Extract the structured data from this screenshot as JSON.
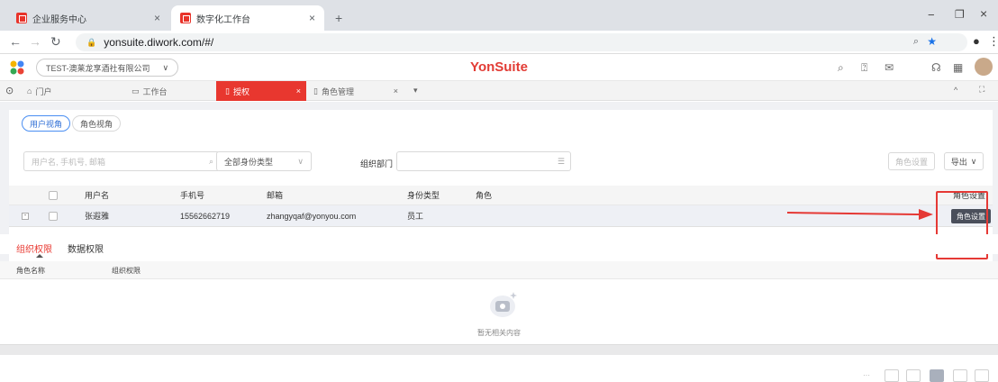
{
  "browser": {
    "tabs": [
      {
        "title": "企业服务中心",
        "close": "×"
      },
      {
        "title": "数字化工作台",
        "close": "×"
      }
    ],
    "new_tab": "+",
    "url": "yonsuite.diwork.com/#/",
    "window_controls": {
      "minimize": "−",
      "restore": "❐",
      "close": "×"
    }
  },
  "header": {
    "company": "TEST-澳莱龙享酒社有限公司",
    "company_caret": "∨",
    "brand": "YonSuite",
    "brand_color": "#e23c35"
  },
  "workspace_tabs": {
    "home": "门户",
    "workbench": "工作台",
    "active": "授权",
    "active_close": "×",
    "role_mgmt": "角色管理",
    "role_mgmt_close": "×",
    "dropdown": "▾",
    "collapse": "^",
    "expand": "⛶",
    "accent": "#e8372f"
  },
  "view_switch": {
    "user_view": "用户视角",
    "role_view": "角色视角"
  },
  "filters": {
    "search_placeholder": "用户名, 手机号, 邮箱",
    "identity_type": "全部身份类型",
    "dept_label": "组织部门"
  },
  "toolbar": {
    "role_setting": "角色设置",
    "export": "导出"
  },
  "table": {
    "columns": [
      "用户名",
      "手机号",
      "邮箱",
      "身份类型",
      "角色"
    ],
    "action_header": "角色设置",
    "rows": [
      {
        "username": "张遐雅",
        "phone": "15562662719",
        "email": "zhangyqaf@yonyou.com",
        "identity": "员工",
        "role": "",
        "action": "角色设置"
      }
    ]
  },
  "subtabs": {
    "org_perm": "组织权限",
    "data_perm": "数据权限",
    "active_color": "#e8372f"
  },
  "subtable": {
    "columns": [
      "角色名称",
      "组织权限"
    ],
    "empty_text": "暂无相关内容"
  },
  "annotation": {
    "arrow_color": "#e53935"
  }
}
